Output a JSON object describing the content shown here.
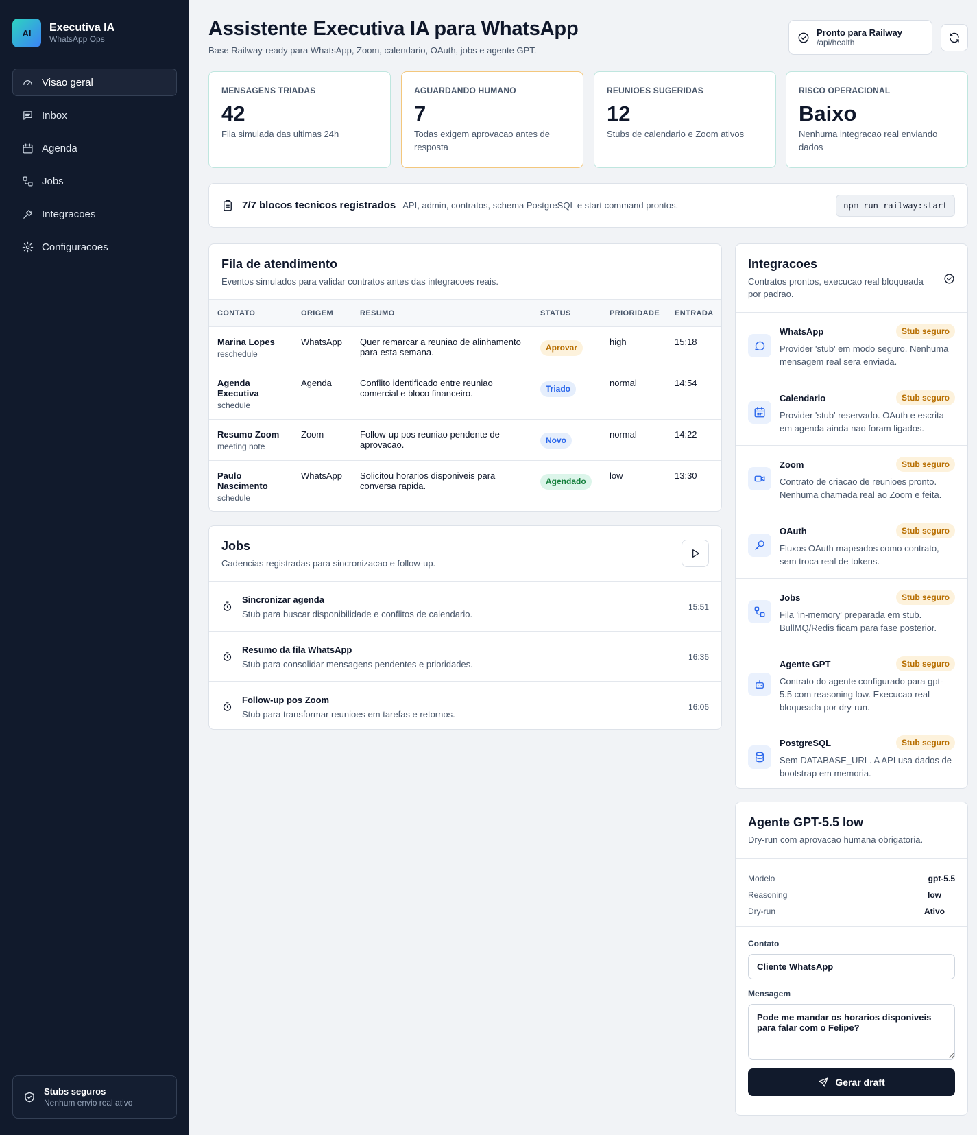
{
  "sidebar": {
    "brand": {
      "logo_text": "AI",
      "title": "Executiva IA",
      "subtitle": "WhatsApp Ops"
    },
    "items": [
      {
        "label": "Visao geral",
        "icon": "gauge-icon",
        "active": true
      },
      {
        "label": "Inbox",
        "icon": "message-square-icon"
      },
      {
        "label": "Agenda",
        "icon": "calendar-icon"
      },
      {
        "label": "Jobs",
        "icon": "workflow-icon"
      },
      {
        "label": "Integracoes",
        "icon": "plug-icon"
      },
      {
        "label": "Configuracoes",
        "icon": "gear-icon"
      }
    ],
    "footer": {
      "title": "Stubs seguros",
      "subtitle": "Nenhum envio real ativo",
      "icon": "shield-check-icon"
    }
  },
  "header": {
    "title": "Assistente Executiva IA para WhatsApp",
    "subtitle": "Base Railway-ready para WhatsApp, Zoom, calendario, OAuth, jobs e agente GPT.",
    "health": {
      "title": "Pronto para Railway",
      "subtitle": "/api/health",
      "icon": "check-circle-icon"
    },
    "refresh_icon": "refresh-icon"
  },
  "stats": [
    {
      "label": "MENSAGENS TRIADAS",
      "value": "42",
      "desc": "Fila simulada das ultimas 24h"
    },
    {
      "label": "AGUARDANDO HUMANO",
      "value": "7",
      "desc": "Todas exigem aprovacao antes de resposta"
    },
    {
      "label": "REUNIOES SUGERIDAS",
      "value": "12",
      "desc": "Stubs de calendario e Zoom ativos"
    },
    {
      "label": "RISCO OPERACIONAL",
      "value": "Baixo",
      "desc": "Nenhuma integracao real enviando dados"
    }
  ],
  "banner": {
    "title": "7/7 blocos tecnicos registrados",
    "desc": "API, admin, contratos, schema PostgreSQL e start command prontos.",
    "command": "npm run railway:start",
    "icon": "clipboard-check-icon"
  },
  "queue": {
    "title": "Fila de atendimento",
    "subtitle": "Eventos simulados para validar contratos antes das integracoes reais.",
    "columns": [
      "CONTATO",
      "ORIGEM",
      "RESUMO",
      "STATUS",
      "PRIORIDADE",
      "ENTRADA"
    ],
    "rows": [
      {
        "name": "Marina Lopes",
        "type": "reschedule",
        "origin": "WhatsApp",
        "summary": "Quer remarcar a reuniao de alinhamento para esta semana.",
        "status": "Aprovar",
        "priority": "high",
        "time": "15:18"
      },
      {
        "name": "Agenda Executiva",
        "type": "schedule",
        "origin": "Agenda",
        "summary": "Conflito identificado entre reuniao comercial e bloco financeiro.",
        "status": "Triado",
        "priority": "normal",
        "time": "14:54"
      },
      {
        "name": "Resumo Zoom",
        "type": "meeting note",
        "origin": "Zoom",
        "summary": "Follow-up pos reuniao pendente de aprovacao.",
        "status": "Novo",
        "priority": "normal",
        "time": "14:22"
      },
      {
        "name": "Paulo Nascimento",
        "type": "schedule",
        "origin": "WhatsApp",
        "summary": "Solicitou horarios disponiveis para conversa rapida.",
        "status": "Agendado",
        "priority": "low",
        "time": "13:30"
      }
    ]
  },
  "jobs": {
    "title": "Jobs",
    "subtitle": "Cadencias registradas para sincronizacao e follow-up.",
    "play_icon": "play-icon",
    "items": [
      {
        "title": "Sincronizar agenda",
        "desc": "Stub para buscar disponibilidade e conflitos de calendario.",
        "time": "15:51"
      },
      {
        "title": "Resumo da fila WhatsApp",
        "desc": "Stub para consolidar mensagens pendentes e prioridades.",
        "time": "16:36"
      },
      {
        "title": "Follow-up pos Zoom",
        "desc": "Stub para transformar reunioes em tarefas e retornos.",
        "time": "16:06"
      }
    ]
  },
  "integrations": {
    "title": "Integracoes",
    "subtitle": "Contratos prontos, execucao real bloqueada por padrao.",
    "items": [
      {
        "name": "WhatsApp",
        "badge": "Stub seguro",
        "desc": "Provider 'stub' em modo seguro. Nenhuma mensagem real sera enviada.",
        "icon": "message-circle-icon"
      },
      {
        "name": "Calendario",
        "badge": "Stub seguro",
        "desc": "Provider 'stub' reservado. OAuth e escrita em agenda ainda nao foram ligados.",
        "icon": "calendar-icon"
      },
      {
        "name": "Zoom",
        "badge": "Stub seguro",
        "desc": "Contrato de criacao de reunioes pronto. Nenhuma chamada real ao Zoom e feita.",
        "icon": "video-icon"
      },
      {
        "name": "OAuth",
        "badge": "Stub seguro",
        "desc": "Fluxos OAuth mapeados como contrato, sem troca real de tokens.",
        "icon": "key-icon"
      },
      {
        "name": "Jobs",
        "badge": "Stub seguro",
        "desc": "Fila 'in-memory' preparada em stub. BullMQ/Redis ficam para fase posterior.",
        "icon": "workflow-icon"
      },
      {
        "name": "Agente GPT",
        "badge": "Stub seguro",
        "desc": "Contrato do agente configurado para gpt-5.5 com reasoning low. Execucao real bloqueada por dry-run.",
        "icon": "bot-icon"
      },
      {
        "name": "PostgreSQL",
        "badge": "Stub seguro",
        "desc": "Sem DATABASE_URL. A API usa dados de bootstrap em memoria.",
        "icon": "database-icon"
      }
    ]
  },
  "agent": {
    "title": "Agente GPT-5.5 low",
    "subtitle": "Dry-run com aprovacao humana obrigatoria.",
    "props": [
      {
        "key": "Modelo",
        "value": "gpt-5.5"
      },
      {
        "key": "Reasoning",
        "value": "low"
      },
      {
        "key": "Dry-run",
        "value": "Ativo"
      }
    ],
    "contact_label": "Contato",
    "contact_value": "Cliente WhatsApp",
    "message_label": "Mensagem",
    "message_value": "Pode me mandar os horarios disponiveis para falar com o Felipe?",
    "button_label": "Gerar draft",
    "button_icon": "send-icon"
  }
}
